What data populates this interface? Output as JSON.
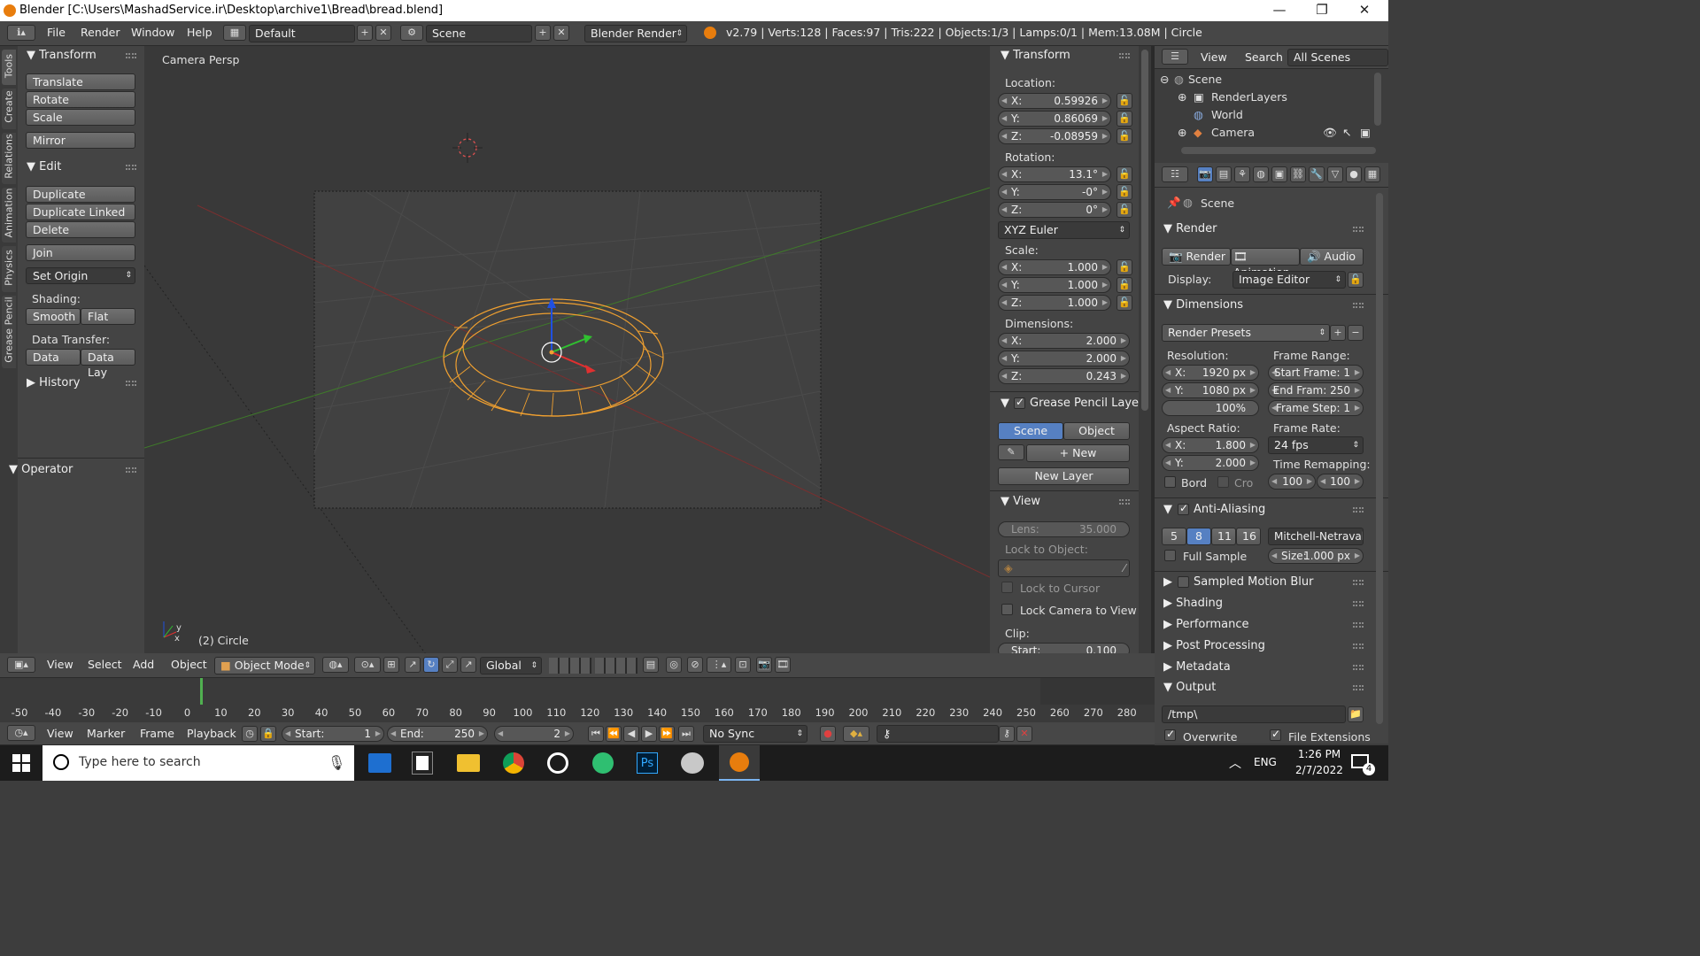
{
  "window": {
    "title": "Blender [C:\\Users\\MashadService.ir\\Desktop\\archive1\\Bread\\bread.blend]",
    "min": "—",
    "max": "❐",
    "close": "✕"
  },
  "topbar": {
    "menus": [
      "File",
      "Render",
      "Window",
      "Help"
    ],
    "layout": "Default",
    "scene": "Scene",
    "engine": "Blender Render",
    "stats": "v2.79 | Verts:128 | Faces:97 | Tris:222 | Objects:1/3 | Lamps:0/1 | Mem:13.08M | Circle"
  },
  "tabs": [
    "Tools",
    "Create",
    "Relations",
    "Animation",
    "Physics",
    "Grease Pencil"
  ],
  "toolshelf": {
    "transform_title": "Transform",
    "translate": "Translate",
    "rotate": "Rotate",
    "scale": "Scale",
    "mirror": "Mirror",
    "edit_title": "Edit",
    "duplicate": "Duplicate",
    "duplicate_linked": "Duplicate Linked",
    "delete": "Delete",
    "join": "Join",
    "set_origin": "Set Origin",
    "shading": "Shading:",
    "smooth": "Smooth",
    "flat": "Flat",
    "data_transfer": "Data Transfer:",
    "data": "Data",
    "data_lay": "Data Lay",
    "history": "History",
    "operator": "Operator"
  },
  "viewport": {
    "label": "Camera Persp",
    "object": "(2) Circle"
  },
  "npanel": {
    "transform": "Transform",
    "location": "Location:",
    "loc": [
      "0.59926",
      "0.86069",
      "-0.08959"
    ],
    "rotation": "Rotation:",
    "rot": [
      "13.1°",
      "-0°",
      "0°"
    ],
    "rot_mode": "XYZ Euler",
    "scale": "Scale:",
    "scl": [
      "1.000",
      "1.000",
      "1.000"
    ],
    "dimensions": "Dimensions:",
    "dim": [
      "2.000",
      "2.000",
      "0.243"
    ],
    "axes": [
      "X:",
      "Y:",
      "Z:"
    ],
    "gp_layer": "Grease Pencil Layer",
    "gp_scene": "Scene",
    "gp_object": "Object",
    "gp_new": "New",
    "gp_new_layer": "New Layer",
    "view": "View",
    "lens": "Lens:",
    "lens_val": "35.000",
    "lock_obj": "Lock to Object:",
    "lock_cursor": "Lock to Cursor",
    "lock_cam": "Lock Camera to View",
    "clip": "Clip:",
    "clip_start": "Start:",
    "clip_start_val": "0.100"
  },
  "outliner": {
    "view": "View",
    "search": "Search",
    "all": "All Scenes",
    "items": [
      "Scene",
      "RenderLayers",
      "World",
      "Camera"
    ]
  },
  "props": {
    "context": "Scene",
    "render_title": "Render",
    "render": "Render",
    "animation": "Animation",
    "audio": "Audio",
    "display": "Display:",
    "display_val": "Image Editor",
    "dimensions": "Dimensions",
    "presets": "Render Presets",
    "resolution": "Resolution:",
    "res_x": "1920 px",
    "res_y": "1080 px",
    "res_pct": "100%",
    "frame_range": "Frame Range:",
    "start_frame": "Start Frame: 1",
    "end_frame": "End Fram: 250",
    "frame_step": "Frame Step: 1",
    "aspect": "Aspect Ratio:",
    "asp_x": "1.800",
    "asp_y": "2.000",
    "frame_rate": "Frame Rate:",
    "fps": "24 fps",
    "remap": "Time Remapping:",
    "remap_a": "100",
    "remap_b": "100",
    "bord": "Bord",
    "cro": "Cro",
    "aa": "Anti-Aliasing",
    "aa_levels": [
      "5",
      "8",
      "11",
      "16"
    ],
    "filter": "Mitchell-Netravali",
    "full_sample": "Full Sample",
    "size": "Size:",
    "size_val": "1.000 px",
    "sections": [
      "Sampled Motion Blur",
      "Shading",
      "Performance",
      "Post Processing",
      "Metadata"
    ],
    "output": "Output",
    "path": "/tmp\\",
    "overwrite": "Overwrite",
    "file_ext": "File Extensions"
  },
  "vhead": {
    "menus": [
      "View",
      "Select",
      "Add",
      "Object"
    ],
    "mode": "Object Mode",
    "orient": "Global"
  },
  "timeline": {
    "ticks": [
      "-50",
      "-40",
      "-30",
      "-20",
      "-10",
      "0",
      "10",
      "20",
      "30",
      "40",
      "50",
      "60",
      "70",
      "80",
      "90",
      "100",
      "110",
      "120",
      "130",
      "140",
      "150",
      "160",
      "170",
      "180",
      "190",
      "200",
      "210",
      "220",
      "230",
      "240",
      "250",
      "260",
      "270",
      "280"
    ]
  },
  "thead": {
    "menus": [
      "View",
      "Marker",
      "Frame",
      "Playback"
    ],
    "start": "Start:",
    "start_val": "1",
    "end": "End:",
    "end_val": "250",
    "current": "2",
    "sync": "No Sync"
  },
  "taskbar": {
    "search": "Type here to search",
    "lang": "ENG",
    "time": "1:26 PM",
    "date": "2/7/2022",
    "notif": "4"
  },
  "colors": {
    "accent": "#5680c2",
    "selection": "#f0a030",
    "bg": "#393939"
  }
}
